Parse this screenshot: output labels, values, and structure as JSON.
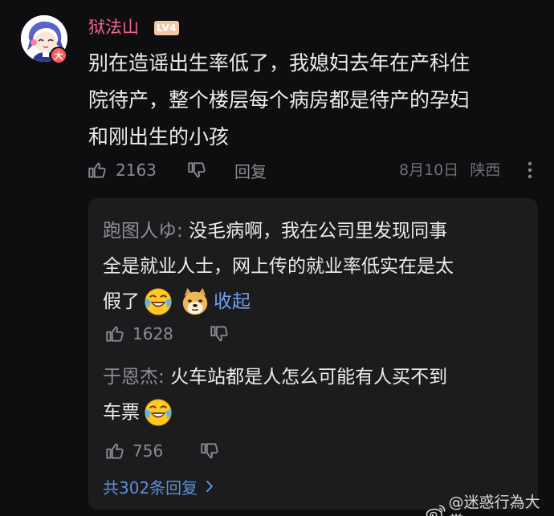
{
  "comment": {
    "username": "狱法山",
    "level": "LV4",
    "badge": "大",
    "text_lines": [
      "别在造谣出生率低了，我媳妇去年在产科住",
      "院待产，整个楼层每个病房都是待产的孕妇",
      "和刚出生的小孩"
    ],
    "likes": "2163",
    "reply_label": "回复",
    "date": "8月10日",
    "location": "陕西"
  },
  "replies": [
    {
      "name": "跑图人ゆ:",
      "lines": [
        "没毛病啊，我在公司里发现同事",
        "全是就业人士，网上传的就业率低实在是太",
        "假了"
      ],
      "collapse_label": "收起",
      "likes": "1628"
    },
    {
      "name": "于恩杰:",
      "lines": [
        "火车站都是人怎么可能有人买不到",
        "车票"
      ],
      "likes": "756"
    }
  ],
  "total_replies": "共302条回复",
  "watermark": "@迷惑行為大賞",
  "icons": {
    "like": "thumbs-up-icon",
    "dislike": "thumbs-down-icon",
    "more": "more-vertical-icon",
    "chevron": "chevron-right-icon",
    "emoji_laugh_cry": "laugh-cry-emoji",
    "emoji_doge": "doge-emoji",
    "weibo": "weibo-logo-icon"
  },
  "colors": {
    "background": "#0e0e10",
    "username": "#f2698f",
    "link": "#6fa0e6",
    "panel": "#1c1c1f"
  }
}
